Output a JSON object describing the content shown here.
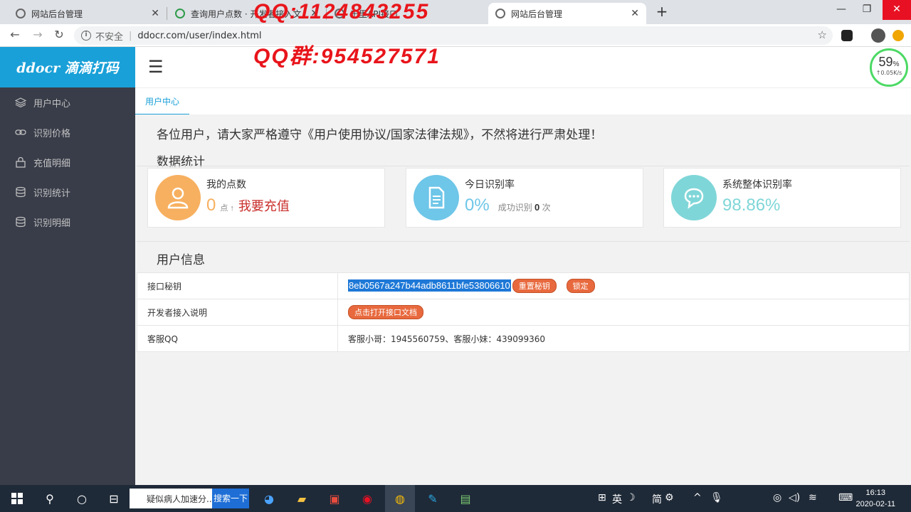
{
  "browser": {
    "tabs": [
      {
        "label": "网站后台管理",
        "active": false
      },
      {
        "label": "查询用户点数 · 开发者接入文",
        "active": false
      },
      {
        "label": "千里API接口",
        "active": false
      },
      {
        "label": "网站后台管理",
        "active": true
      }
    ],
    "new_tab": "+",
    "insecure_label": "不安全",
    "url_separator": "|",
    "url": "ddocr.com/user/index.html"
  },
  "watermarks": {
    "qq": "QQ:1124843255",
    "qq_group": "QQ群:954527571"
  },
  "speed_badge": {
    "percent": "59",
    "percent_sign": "%",
    "rate": "↑0.05K/s"
  },
  "sidebar": {
    "logo": "ddocr 滴滴打码",
    "items": [
      {
        "label": "用户中心",
        "icon": "layers-icon"
      },
      {
        "label": "识别价格",
        "icon": "link-icon"
      },
      {
        "label": "充值明细",
        "icon": "lock-icon"
      },
      {
        "label": "识别统计",
        "icon": "database-icon"
      },
      {
        "label": "识别明细",
        "icon": "database-icon"
      }
    ]
  },
  "subtab": {
    "label": "用户中心"
  },
  "notice": "各位用户，请大家严格遵守《用户使用协议/国家法律法规》，不然将进行严肃处理！",
  "stats": {
    "title": "数据统计",
    "cards": [
      {
        "title": "我的点数",
        "value": "0",
        "unit": "点 ↑",
        "action": "我要充值",
        "color": "#f7b060"
      },
      {
        "title": "今日识别率",
        "value": "0%",
        "sub_label": "成功识别",
        "sub_value": "0",
        "sub_unit": "次",
        "color": "#6ec6e8"
      },
      {
        "title": "系统整体识别率",
        "value": "98.86%",
        "color": "#7fd6d8"
      }
    ]
  },
  "user_info": {
    "title": "用户信息",
    "rows": [
      {
        "label": "接口秘钥",
        "value": "8eb0567a247b44adb8611bfe53806610",
        "buttons": [
          "重置秘钥",
          "锁定"
        ]
      },
      {
        "label": "开发者接入说明",
        "buttons": [
          "点击打开接口文档"
        ]
      },
      {
        "label": "客服QQ",
        "value": "客服小哥：1945560759、客服小妹：439099360"
      }
    ]
  },
  "taskbar": {
    "search_text": "疑似病人加速分...",
    "search_button": "搜索一下",
    "ime_text": "英",
    "ime_mode": "简",
    "time": "16:13",
    "date": "2020-02-11"
  }
}
